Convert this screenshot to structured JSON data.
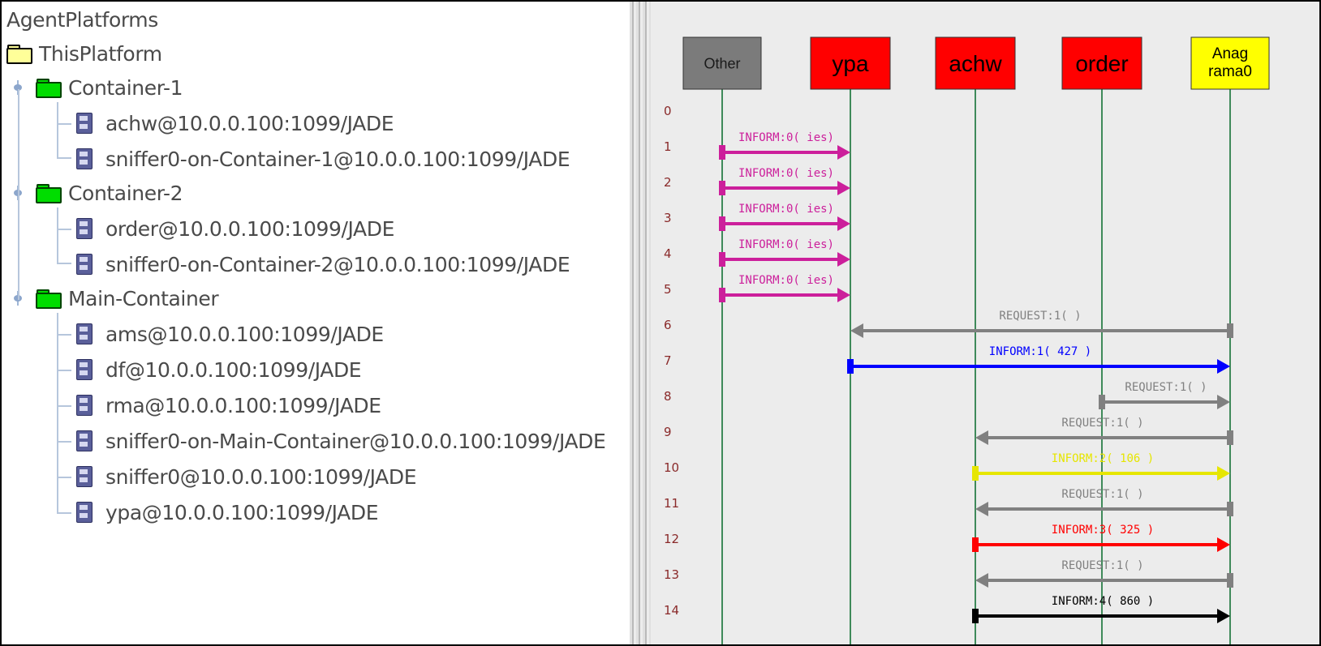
{
  "tree": {
    "root": "AgentPlatforms",
    "platform": "ThisPlatform",
    "containers": [
      {
        "name": "Container-1",
        "agents": [
          "achw@10.0.0.100:1099/JADE",
          "sniffer0-on-Container-1@10.0.0.100:1099/JADE"
        ]
      },
      {
        "name": "Container-2",
        "agents": [
          "order@10.0.0.100:1099/JADE",
          "sniffer0-on-Container-2@10.0.0.100:1099/JADE"
        ]
      },
      {
        "name": "Main-Container",
        "agents": [
          "ams@10.0.0.100:1099/JADE",
          "df@10.0.0.100:1099/JADE",
          "rma@10.0.0.100:1099/JADE",
          "sniffer0-on-Main-Container@10.0.0.100:1099/JADE",
          "sniffer0@10.0.0.100:1099/JADE",
          "ypa@10.0.0.100:1099/JADE"
        ]
      }
    ]
  },
  "sniffer": {
    "agents": [
      {
        "label": "Other",
        "color": "#7b7b7b",
        "text_color": "#1a1a1a"
      },
      {
        "label": "ypa",
        "color": "#ff0000",
        "text_color": "#000000"
      },
      {
        "label": "achw",
        "color": "#ff0000",
        "text_color": "#000000"
      },
      {
        "label": "order",
        "color": "#ff0000",
        "text_color": "#000000"
      },
      {
        "label": "Anag rama0",
        "color": "#ffff00",
        "text_color": "#000000"
      }
    ],
    "row_numbers": [
      "0",
      "1",
      "2",
      "3",
      "4",
      "5",
      "6",
      "7",
      "8",
      "9",
      "10",
      "11",
      "12",
      "13",
      "14"
    ],
    "messages": [
      {
        "row": 1,
        "from": 0,
        "to": 1,
        "label": "INFORM:0(   ies)",
        "color": "#cc1f9b"
      },
      {
        "row": 2,
        "from": 0,
        "to": 1,
        "label": "INFORM:0(   ies)",
        "color": "#cc1f9b"
      },
      {
        "row": 3,
        "from": 0,
        "to": 1,
        "label": "INFORM:0(   ies)",
        "color": "#cc1f9b"
      },
      {
        "row": 4,
        "from": 0,
        "to": 1,
        "label": "INFORM:0(   ies)",
        "color": "#cc1f9b"
      },
      {
        "row": 5,
        "from": 0,
        "to": 1,
        "label": "INFORM:0(   ies)",
        "color": "#cc1f9b"
      },
      {
        "row": 6,
        "from": 4,
        "to": 1,
        "label": "REQUEST:1(     )",
        "color": "#808080"
      },
      {
        "row": 7,
        "from": 1,
        "to": 4,
        "label": "INFORM:1(  427   )",
        "color": "#0000ff"
      },
      {
        "row": 8,
        "from": 3,
        "to": 4,
        "label": "REQUEST:1(     )",
        "color": "#808080"
      },
      {
        "row": 9,
        "from": 4,
        "to": 2,
        "label": "REQUEST:1(     )",
        "color": "#808080"
      },
      {
        "row": 10,
        "from": 2,
        "to": 4,
        "label": "INFORM:2(  106   )",
        "color": "#e6e600"
      },
      {
        "row": 11,
        "from": 4,
        "to": 2,
        "label": "REQUEST:1(     )",
        "color": "#808080"
      },
      {
        "row": 12,
        "from": 2,
        "to": 4,
        "label": "INFORM:3(  325   )",
        "color": "#ff0000"
      },
      {
        "row": 13,
        "from": 4,
        "to": 2,
        "label": "REQUEST:1(     )",
        "color": "#808080"
      },
      {
        "row": 14,
        "from": 2,
        "to": 4,
        "label": "INFORM:4(  860   )",
        "color": "#000000"
      }
    ]
  }
}
